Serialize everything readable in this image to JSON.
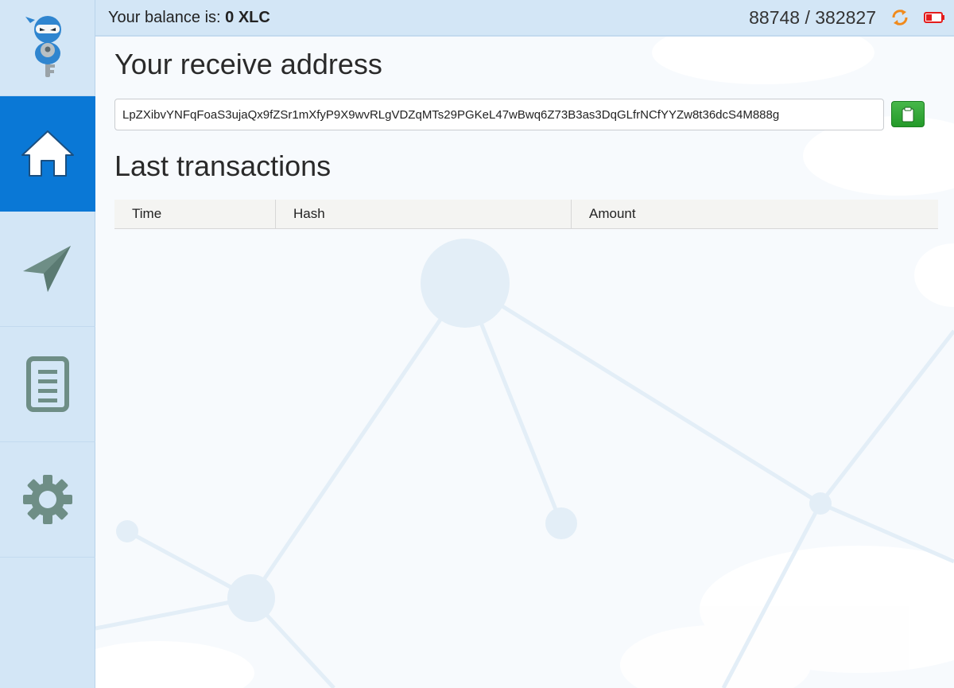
{
  "app": {
    "balance_label": "Your balance is:",
    "balance_value": "0 XLC",
    "block_progress": "88748 / 382827",
    "icons": {
      "logo": "ninja-key-logo",
      "sync": "sync-icon",
      "battery": "battery-low-icon"
    },
    "colors": {
      "sidebar": "#d3e6f6",
      "active_nav": "#0a78d6",
      "icon": "#6e8e86",
      "sync": "#f08a1c",
      "battery": "#e41c1c",
      "copy_button": "#2fa535"
    }
  },
  "sidebar": {
    "items": [
      {
        "name": "home",
        "icon": "home-icon",
        "active": true
      },
      {
        "name": "send",
        "icon": "send-icon",
        "active": false
      },
      {
        "name": "transactions",
        "icon": "document-icon",
        "active": false
      },
      {
        "name": "settings",
        "icon": "gear-icon",
        "active": false
      }
    ]
  },
  "receive": {
    "title": "Your receive address",
    "address": "LpZXibvYNFqFoaS3ujaQx9fZSr1mXfyP9X9wvRLgVDZqMTs29PGKeL47wBwq6Z73B3as3DqGLfrNCfYYZw8t36dcS4M888g",
    "copy_icon": "clipboard-icon"
  },
  "transactions": {
    "title": "Last transactions",
    "columns": [
      "Time",
      "Hash",
      "Amount"
    ],
    "rows": []
  }
}
